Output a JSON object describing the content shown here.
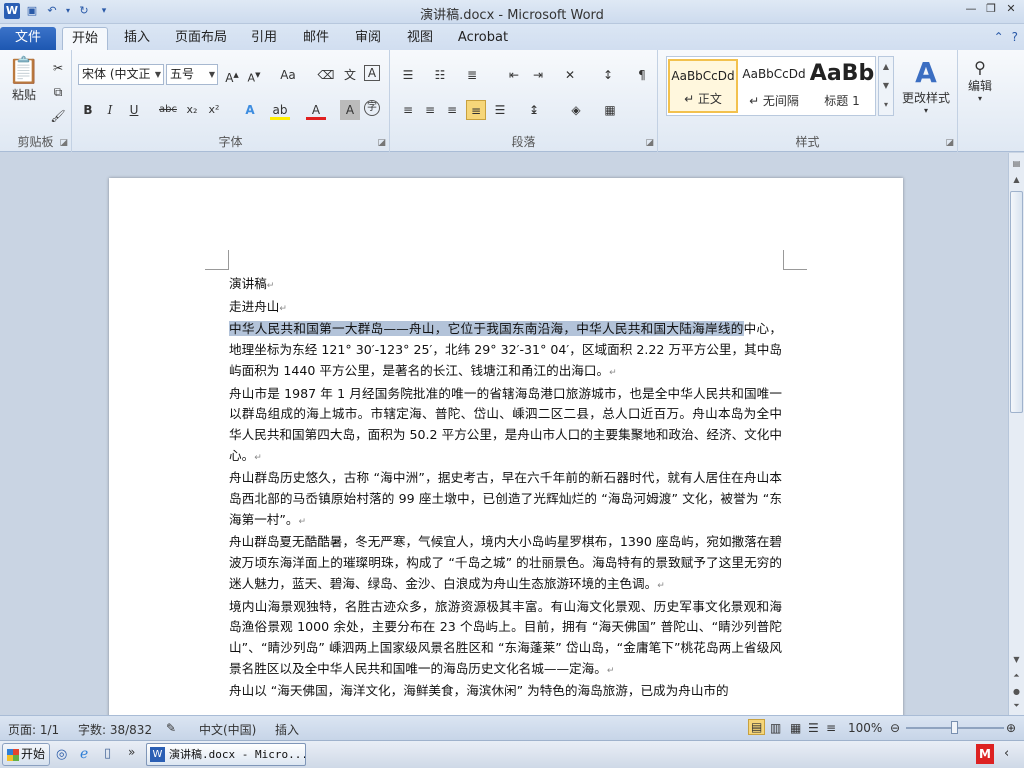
{
  "window": {
    "title": "演讲稿.docx - Microsoft Word"
  },
  "ribbon_tabs": [
    "文件",
    "开始",
    "插入",
    "页面布局",
    "引用",
    "邮件",
    "审阅",
    "视图",
    "Acrobat"
  ],
  "clipboard": {
    "paste_label": "粘贴",
    "group_label": "剪贴板"
  },
  "font": {
    "font_name": "宋体 (中文正",
    "font_size": "五号",
    "group_label": "字体"
  },
  "paragraph": {
    "group_label": "段落"
  },
  "styles": {
    "items": [
      {
        "sample": "AaBbCcDd",
        "name": "↵ 正文"
      },
      {
        "sample": "AaBbCcDd",
        "name": "↵ 无间隔"
      },
      {
        "sample": "AaBb",
        "name": "标题 1"
      }
    ],
    "change_styles": "更改样式",
    "group_label": "样式"
  },
  "editing": {
    "label": "编辑"
  },
  "document": {
    "paragraphs": [
      {
        "text": "演讲稿"
      },
      {
        "text": "走进舟山"
      },
      {
        "highlight": "中华人民共和国第一大群岛——舟山，它位于我国东南沿海，中华人民共和国大陆海岸线的",
        "text": "中心，地理坐标为东经 121° 30′-123° 25′，北纬 29° 32′-31° 04′，区域面积 2.22 万平方公里，其中岛屿面积为 1440 平方公里，是著名的长江、钱塘江和甬江的出海口。"
      },
      {
        "text": "舟山市是 1987 年 1 月经国务院批准的唯一的省辖海岛港口旅游城市，也是全中华人民共和国唯一以群岛组成的海上城市。市辖定海、普陀、岱山、嵊泗二区二县，总人口近百万。舟山本岛为全中华人民共和国第四大岛，面积为 50.2 平方公里，是舟山市人口的主要集聚地和政治、经济、文化中心。"
      },
      {
        "text": "舟山群岛历史悠久，古称 “海中洲”，据史考古，早在六千年前的新石器时代，就有人居住在舟山本岛西北部的马岙镇原始村落的 99 座土墩中，已创造了光辉灿烂的 “海岛河姆渡” 文化，被誉为 “东海第一村”。"
      },
      {
        "text": "舟山群岛夏无酷酷暑，冬无严寒，气候宜人，境内大小岛屿星罗棋布，1390 座岛屿，宛如撒落在碧波万顷东海洋面上的璀璨明珠，构成了 “千岛之城” 的壮丽景色。海岛特有的景致赋予了这里无穷的迷人魅力，蓝天、碧海、绿岛、金沙、白浪成为舟山生态旅游环境的主色调。"
      },
      {
        "text": "境内山海景观独特，名胜古迹众多，旅游资源极其丰富。有山海文化景观、历史军事文化景观和海岛渔俗景观 1000 余处，主要分布在 23 个岛屿上。目前，拥有 “海天佛国” 普陀山、“睛沙列普陀山”、“睛沙列岛” 嵊泗两上国家级风景名胜区和 “东海蓬莱” 岱山岛，“金庸笔下”桃花岛两上省级风景名胜区以及全中华人民共和国唯一的海岛历史文化名城——定海。"
      },
      {
        "text": "舟山以 “海天佛国，海洋文化，海鲜美食，海滨休闲” 为特色的海岛旅游，已成为舟山市的"
      }
    ]
  },
  "status": {
    "page": "页面: 1/1",
    "words": "字数: 38/832",
    "language": "中文(中国)",
    "mode": "插入",
    "zoom": "100%",
    "zoom_level": 1.0
  },
  "taskbar": {
    "start": "开始",
    "app_title": "演讲稿.docx - Micro..."
  }
}
